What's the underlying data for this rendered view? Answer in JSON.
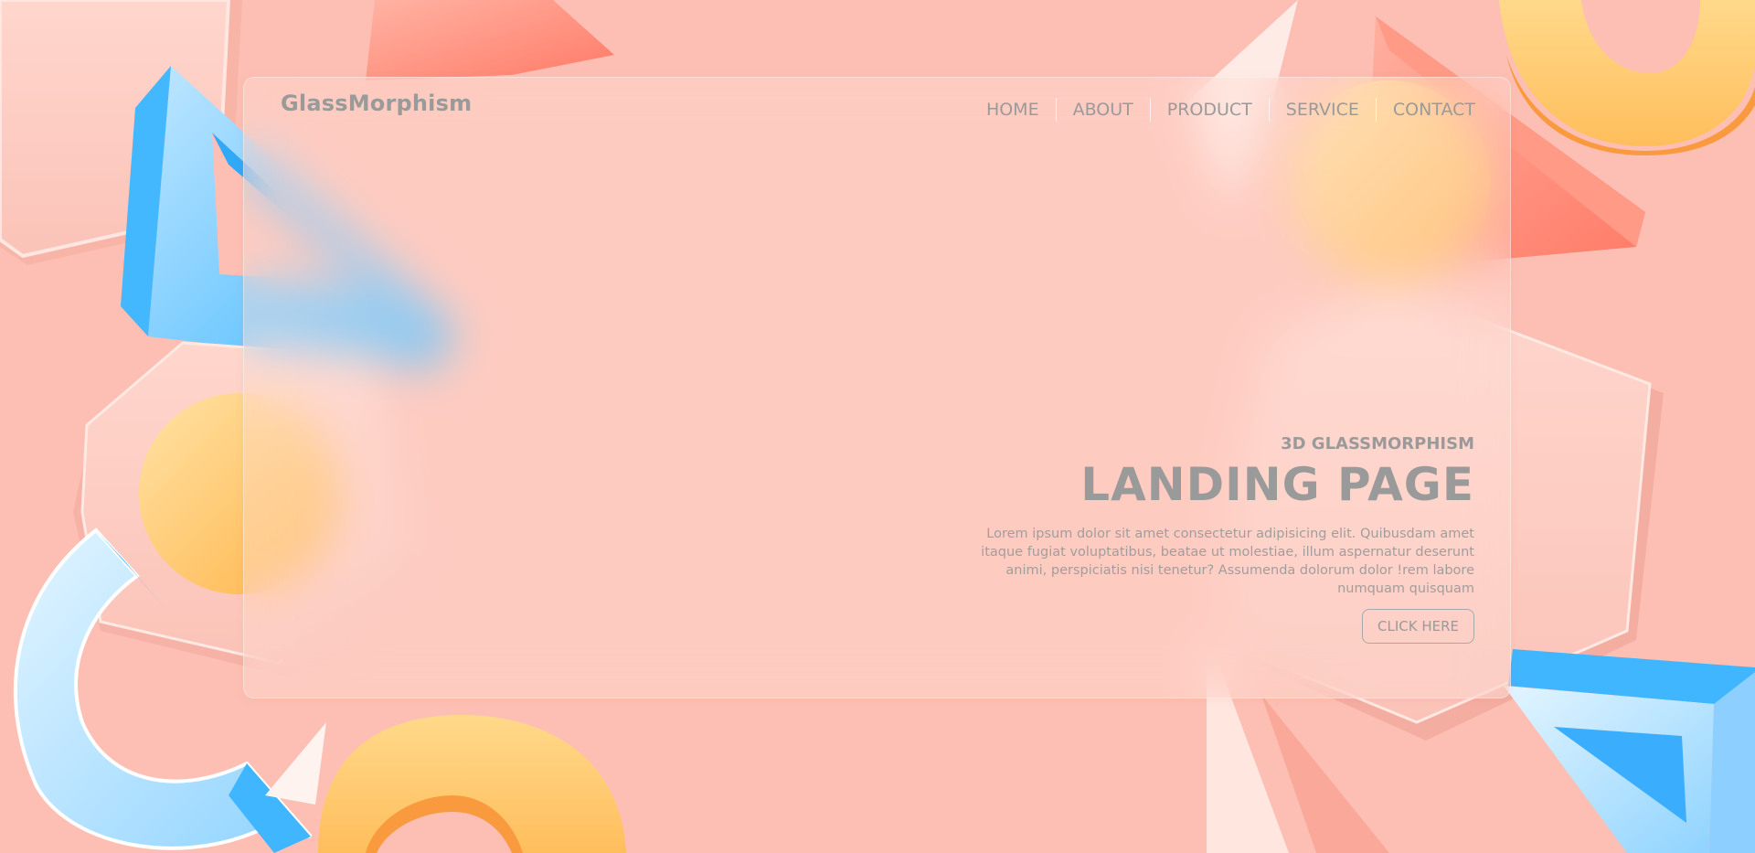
{
  "brand": "GlassMorphism",
  "nav": [
    {
      "label": "HOME"
    },
    {
      "label": "ABOUT"
    },
    {
      "label": "PRODUCT"
    },
    {
      "label": "SERVICE"
    },
    {
      "label": "CONTACT"
    }
  ],
  "hero": {
    "kicker": "3D GLASSMORPHISM",
    "title": "LANDING PAGE",
    "description": "Lorem ipsum dolor sit amet consectetur adipisicing elit. Quibusdam amet itaque fugiat voluptatibus, beatae ut molestiae, illum aspernatur deserunt animi, perspiciatis nisi tenetur? Assumenda dolorum dolor !rem labore numquam quisquam",
    "cta_label": "CLICK HERE"
  },
  "colors": {
    "background": "#fdbfb3",
    "text": "#9a9a9a",
    "blue": "#3fb6ff",
    "yellow": "#ffc86e",
    "coral": "#ff8573"
  }
}
